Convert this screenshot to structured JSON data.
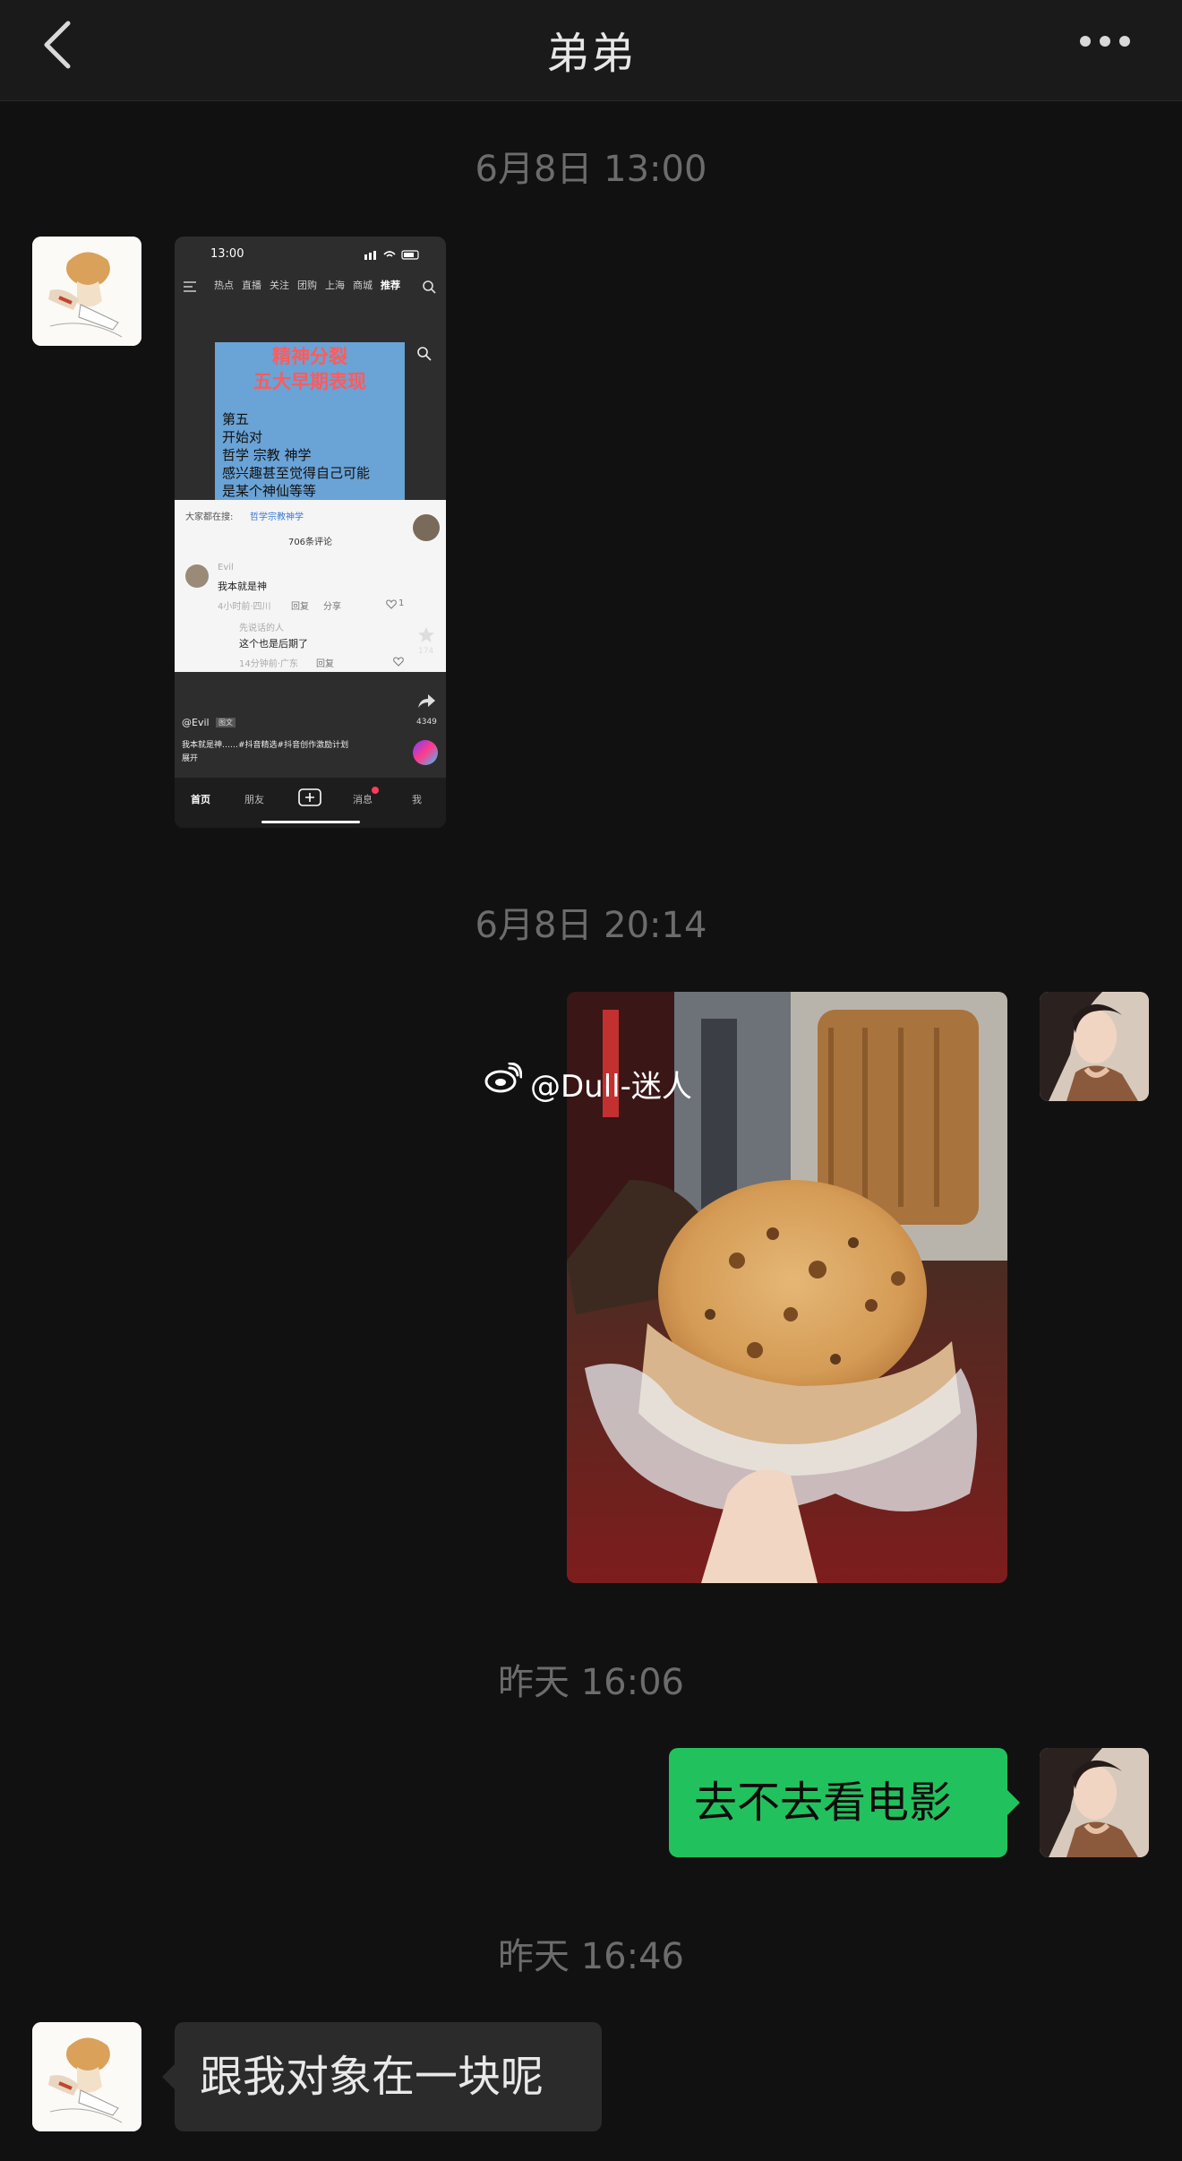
{
  "header": {
    "title": "弟弟"
  },
  "icons": {
    "back": "chevron-left-icon",
    "more": "more-dots-icon",
    "weibo": "weibo-icon"
  },
  "colors": {
    "accent_green": "#21c25e",
    "background": "#111111",
    "bubble_gray": "#2b2b2b"
  },
  "timestamps": [
    "6月8日 13:00",
    "6月8日 20:14",
    "昨天 16:06",
    "昨天 16:46"
  ],
  "messages": {
    "m1": {
      "sender": "contact",
      "screenshot": {
        "time": "13:00",
        "tabs": [
          "热点",
          "直播",
          "关注",
          "团购",
          "上海",
          "商城",
          "推荐"
        ],
        "video_title": [
          "精神分裂",
          "五大早期表现"
        ],
        "video_lines": [
          "第五",
          "开始对",
          "哲学 宗教 神学",
          "感兴趣甚至觉得自己可能",
          "是某个神仙等等"
        ],
        "search_prefix": "大家都在搜:",
        "search_term": "哲学宗教神学",
        "comment_count": "706条评论",
        "c1_user": "Evil",
        "c1_text": "我本就是神",
        "c1_meta": "4小时前·四川",
        "reply": "回复",
        "share": "分享",
        "c1_likes": "1",
        "c2_user": "先说话的人",
        "c2_text": "这个也是后期了",
        "c2_meta": "14分钟前·广东",
        "favorites": "174",
        "shares": "4349",
        "author": "@Evil",
        "author_tag": "图文",
        "caption": "我本就是神……#抖音精选#抖音创作激励计划",
        "expand": "展开",
        "nav": [
          "首页",
          "朋友",
          "消息",
          "我"
        ]
      }
    },
    "m2": {
      "sender": "me",
      "watermark": "@Dull-迷人"
    },
    "m3": {
      "sender": "me",
      "text": "去不去看电影"
    },
    "m4": {
      "sender": "contact",
      "text": "跟我对象在一块呢"
    }
  }
}
